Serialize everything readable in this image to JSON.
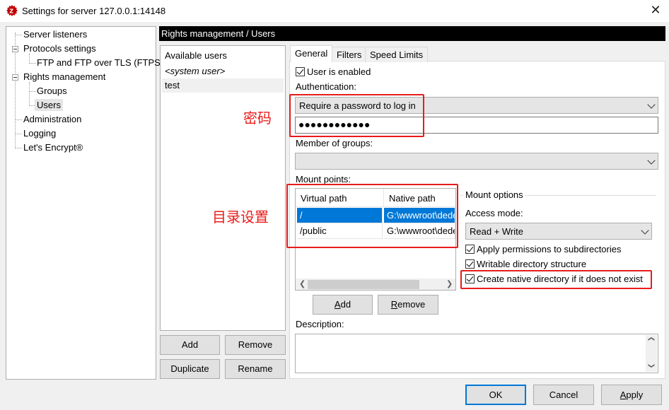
{
  "window": {
    "title": "Settings for server 127.0.0.1:14148",
    "close_glyph": "✕",
    "icon": "filezilla-server-icon"
  },
  "tree": {
    "items": [
      {
        "label": "Server listeners"
      },
      {
        "label": "Protocols settings"
      },
      {
        "label": "FTP and FTP over TLS (FTPS)"
      },
      {
        "label": "Rights management"
      },
      {
        "label": "Groups"
      },
      {
        "label": "Users"
      },
      {
        "label": "Administration"
      },
      {
        "label": "Logging"
      },
      {
        "label": "Let's Encrypt®"
      }
    ]
  },
  "page": {
    "header": "Rights management / Users"
  },
  "users": {
    "heading": "Available users",
    "items": [
      "<system user>",
      "test"
    ],
    "buttons": {
      "add": "Add",
      "remove": "Remove",
      "duplicate": "Duplicate",
      "rename": "Rename"
    }
  },
  "tabs": [
    "General",
    "Filters",
    "Speed Limits"
  ],
  "general": {
    "user_enabled_label": "User is enabled",
    "user_enabled": true,
    "auth_label": "Authentication:",
    "auth_value": "Require a password to log in",
    "password_mask": "●●●●●●●●●●●●",
    "groups_label": "Member of groups:",
    "groups_value": "",
    "mount_label": "Mount points:",
    "mount_columns": [
      "Virtual path",
      "Native path"
    ],
    "mount_rows": [
      {
        "virtual": "/",
        "native": "G:\\wwwroot\\dede"
      },
      {
        "virtual": "/public",
        "native": "G:\\wwwroot\\dede"
      }
    ],
    "mount_add": "Add",
    "mount_remove": "Remove",
    "mount_options_label": "Mount options",
    "access_mode_label": "Access mode:",
    "access_mode_value": "Read + Write",
    "apply_perms_label": "Apply permissions to subdirectories",
    "writable_label": "Writable directory structure",
    "create_native_label": "Create native directory if it does not exist",
    "description_label": "Description:",
    "description_value": ""
  },
  "annotations": {
    "password": "密码",
    "directory": "目录设置"
  },
  "footer": {
    "ok": "OK",
    "cancel": "Cancel",
    "apply": "Apply"
  },
  "colors": {
    "annotation_red": "#e81b1b",
    "selection_blue": "#0078d7"
  }
}
